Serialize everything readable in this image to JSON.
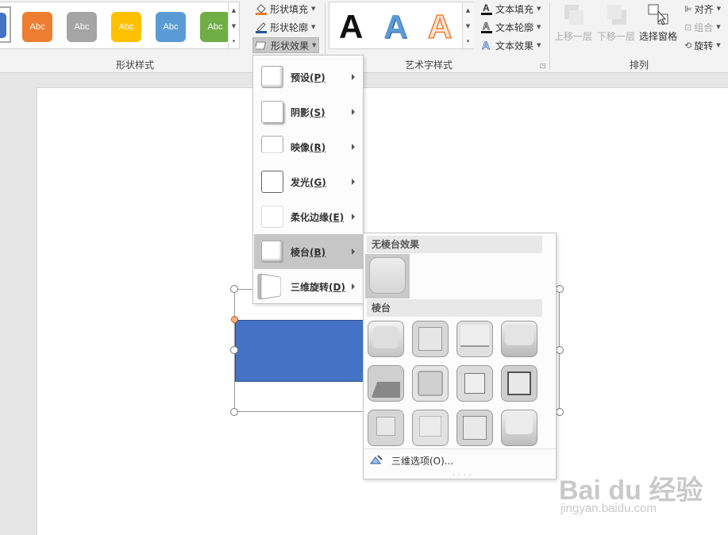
{
  "ribbon": {
    "shape_styles": {
      "group_label": "形状样式",
      "swatches": [
        {
          "label": "Abc",
          "color": "#ed7d31"
        },
        {
          "label": "Abc",
          "color": "#a5a5a5"
        },
        {
          "label": "Abc",
          "color": "#ffc000"
        },
        {
          "label": "Abc",
          "color": "#5b9bd5"
        },
        {
          "label": "Abc",
          "color": "#70ad47"
        }
      ],
      "commands": {
        "fill": "形状填充",
        "outline": "形状轮廓",
        "effects": "形状效果"
      }
    },
    "wordart": {
      "group_label": "艺术字样式",
      "samples": [
        {
          "label": "A"
        },
        {
          "label": "A"
        },
        {
          "label": "A"
        }
      ],
      "commands": {
        "text_fill": "文本填充",
        "text_outline": "文本轮廓",
        "text_effects": "文本效果"
      }
    },
    "arrange": {
      "group_label": "排列",
      "bring_forward": "上移一层",
      "send_backward": "下移一层",
      "selection_pane": "选择窗格",
      "align": "对齐",
      "group": "组合",
      "rotate": "旋转"
    }
  },
  "effects_menu": {
    "items": [
      {
        "label": "预设",
        "key": "(P)"
      },
      {
        "label": "阴影",
        "key": "(S)"
      },
      {
        "label": "映像",
        "key": "(R)"
      },
      {
        "label": "发光",
        "key": "(G)"
      },
      {
        "label": "柔化边缘",
        "key": "(E)"
      },
      {
        "label": "棱台",
        "key": "(B)"
      },
      {
        "label": "三维旋转",
        "key": "(D)"
      }
    ],
    "active_index": 5
  },
  "bevel_submenu": {
    "no_bevel_header": "无棱台效果",
    "bevel_header": "棱台",
    "options_label": "三维选项(O)...",
    "tile_count": 12
  },
  "watermark": {
    "brand": "Bai du 经验",
    "url": "jingyan.baidu.com"
  },
  "colors": {
    "shape_fill": "#4472c4",
    "selection_handle_yellow": "#f4b183"
  }
}
